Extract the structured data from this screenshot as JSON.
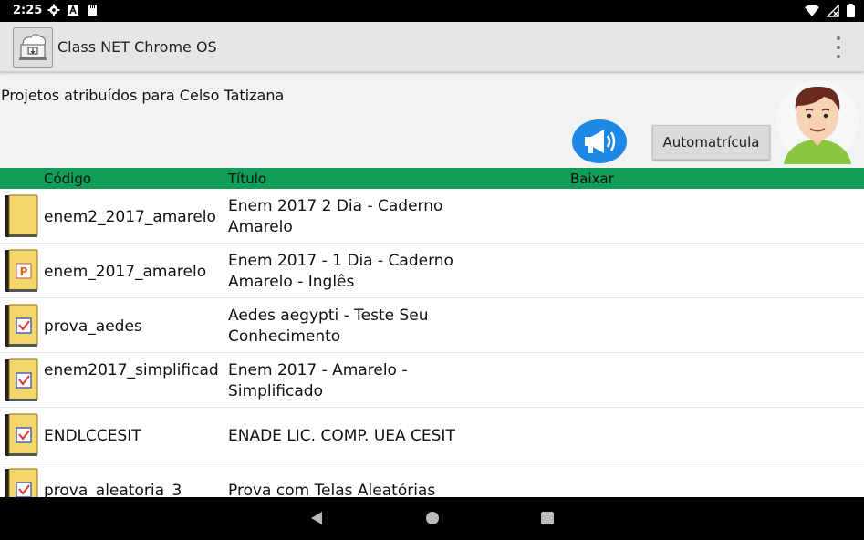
{
  "status_bar": {
    "time": "2:25",
    "icons": [
      "gear-icon",
      "a-box-icon",
      "sd-card-icon",
      "wifi-icon",
      "no-signal-icon",
      "battery-icon"
    ]
  },
  "app_bar": {
    "title": "Class NET Chrome OS",
    "icon": "class-net-app-icon",
    "menu_icon": "overflow-menu-icon"
  },
  "header": {
    "assigned_text": "Projetos atribuídos para Celso Tatizana",
    "auto_button_label": "Automatrícula",
    "announce_icon": "megaphone-icon",
    "avatar_icon": "user-avatar-icon"
  },
  "table": {
    "columns": [
      "Código",
      "Título",
      "Baixar"
    ],
    "rows": [
      {
        "code": "enem2_2017_amarelo",
        "title": "Enem 2017 2  Dia - Caderno Amarelo",
        "icon": "book-plain-icon"
      },
      {
        "code": "enem_2017_amarelo",
        "title": "Enem 2017 - 1  Dia - Caderno Amarelo - Inglês",
        "icon": "book-p-icon"
      },
      {
        "code": "prova_aedes",
        "title": "Aedes aegypti - Teste Seu Conhecimento",
        "icon": "book-check-icon"
      },
      {
        "code": "enem2017_simplificad",
        "title": "Enem 2017 - Amarelo - Simplificado",
        "icon": "book-check-icon"
      },
      {
        "code": "ENDLCCESIT",
        "title": "ENADE LIC. COMP. UEA CESIT",
        "icon": "book-check-icon"
      },
      {
        "code": "prova_aleatoria_3",
        "title": "Prova com Telas Aleatórias",
        "icon": "book-check-icon"
      }
    ]
  },
  "nav_bar": {
    "icons": [
      "back-icon",
      "home-icon",
      "recents-icon"
    ]
  },
  "colors": {
    "header_green": "#0f9d58",
    "megaphone_blue": "#1e88e5",
    "book_yellow": "#f3d76a"
  }
}
